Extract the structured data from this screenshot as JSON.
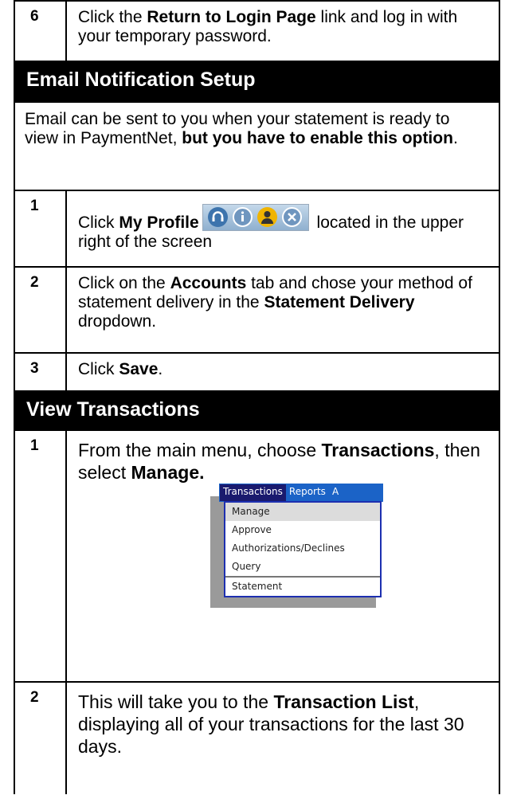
{
  "step6": {
    "number": "6",
    "pre": "Click the ",
    "link": "Return to Login Page",
    "post": " link and log in with your temporary password."
  },
  "email_section": {
    "title": "Email Notification Setup",
    "intro_pre": "Email can be sent to you when your statement is ready to view in PaymentNet, ",
    "intro_bold": "but you have to enable this option",
    "intro_post": ".",
    "steps": [
      {
        "number": "1",
        "pre": "Click ",
        "bold": "My Profile",
        "post": " located in the upper right of the screen",
        "icons": [
          "headset-icon",
          "info-icon",
          "profile-icon",
          "close-icon"
        ]
      },
      {
        "number": "2",
        "pre": "Click on the ",
        "bold": "Accounts",
        "mid": " tab and chose your method of statement delivery in the ",
        "bold2": "Statement Delivery",
        "post": " dropdown."
      },
      {
        "number": "3",
        "pre": "Click ",
        "bold": "Save",
        "post": "."
      }
    ]
  },
  "transactions_section": {
    "title": "View Transactions",
    "step1": {
      "number": "1",
      "pre": "From the main menu, choose ",
      "bold": "Transactions",
      "mid": ", then select ",
      "bold2": "Manage."
    },
    "menu": {
      "bar": [
        "Transactions",
        "Reports",
        "A"
      ],
      "items": [
        "Manage",
        "Approve",
        "Authorizations/Declines",
        "Query",
        "Statement"
      ],
      "colors": {
        "bar": "#1b63c7",
        "active": "#1a1a6e",
        "highlight": "#dcdcdc"
      }
    },
    "step2": {
      "number": "2",
      "pre": "This will take you to the ",
      "bold": "Transaction List",
      "post": ", displaying all of your transactions for the last 30 days."
    }
  }
}
